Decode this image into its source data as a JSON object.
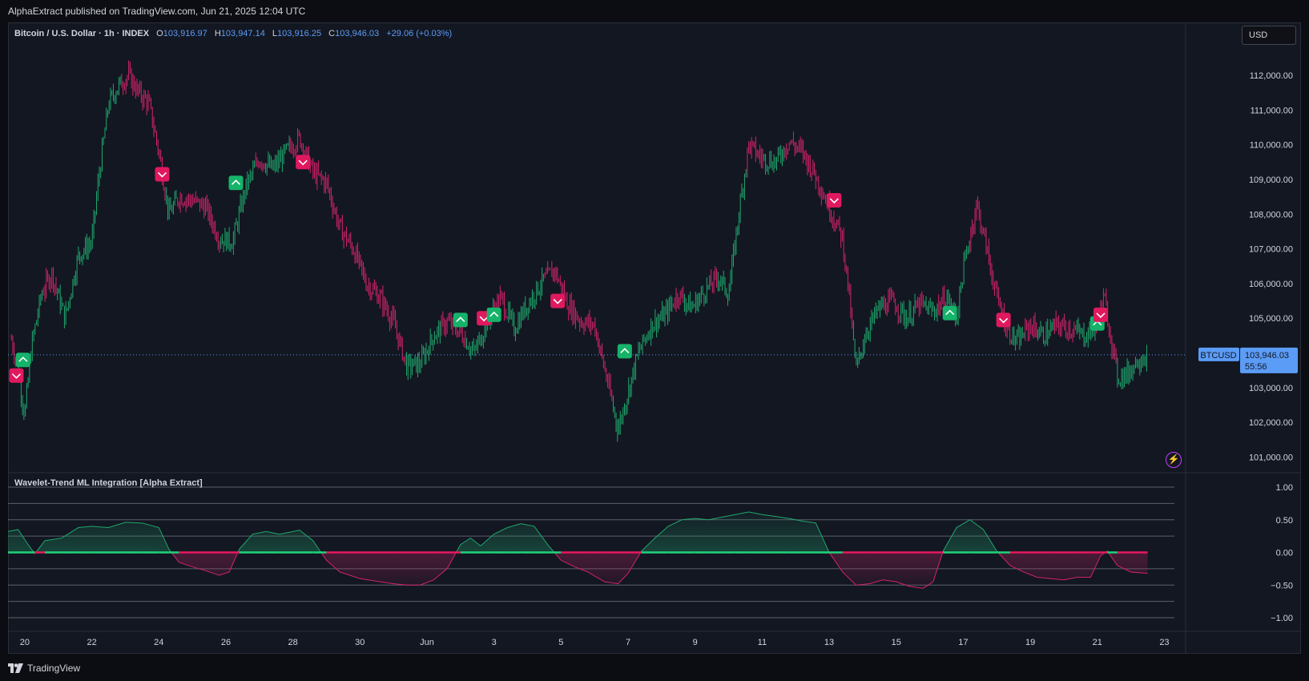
{
  "header": {
    "published": "AlphaExtract published on TradingView.com, Jun 21, 2025 12:04 UTC"
  },
  "symbol": {
    "name": "Bitcoin / U.S. Dollar · 1h · INDEX",
    "o_label": "O",
    "o_value": "103,916.97",
    "h_label": "H",
    "h_value": "103,947.14",
    "l_label": "L",
    "l_value": "103,916.25",
    "c_label": "C",
    "c_value": "103,946.03",
    "change": "+29.06 (+0.03%)"
  },
  "currency_button": "USD",
  "price_badge": {
    "ticker": "BTCUSD",
    "price": "103,946.03",
    "countdown": "55:56"
  },
  "indicator": {
    "title": "Wavelet-Trend ML Integration [Alpha Extract]"
  },
  "footer": {
    "brand": "TradingView"
  },
  "colors": {
    "up": "#089981",
    "down": "#f23645",
    "bull_candle": "#1fa86c",
    "bear_candle": "#d4236a",
    "accent": "#2962ff",
    "badge": "#5b9cf6",
    "background": "#131722"
  },
  "icons": [
    "tradingview-logo-icon",
    "lightning-icon",
    "buy-signal-icon",
    "sell-signal-icon"
  ],
  "chart_data": [
    {
      "type": "line",
      "name": "BTCUSD 1h price",
      "y_ticks": [
        "112,000.00",
        "111,000.00",
        "110,000.00",
        "109,000.00",
        "108,000.00",
        "107,000.00",
        "106,000.00",
        "105,000.00",
        "103,000.00",
        "102,000.00",
        "101,000.00"
      ],
      "ylim": [
        100550,
        112600
      ],
      "x_ticks": [
        "20",
        "22",
        "24",
        "26",
        "28",
        "30",
        "Jun",
        "3",
        "5",
        "7",
        "9",
        "11",
        "13",
        "15",
        "17",
        "19",
        "21",
        "23"
      ],
      "x_tick_index": [
        0,
        2,
        4,
        6,
        8,
        10,
        12,
        14,
        16,
        18,
        20,
        22,
        24,
        26,
        28,
        30,
        32,
        34
      ],
      "x_span_days": [
        -0.5,
        34.3
      ],
      "last_price": 103946.03,
      "series_points": [
        [
          -0.4,
          104400
        ],
        [
          -0.2,
          103500
        ],
        [
          0,
          102200
        ],
        [
          0.2,
          104200
        ],
        [
          0.5,
          105700
        ],
        [
          0.8,
          106300
        ],
        [
          1.2,
          105000
        ],
        [
          1.6,
          106800
        ],
        [
          2,
          107200
        ],
        [
          2.2,
          109000
        ],
        [
          2.5,
          111200
        ],
        [
          2.8,
          111700
        ],
        [
          3.1,
          112000
        ],
        [
          3.4,
          111500
        ],
        [
          3.7,
          111200
        ],
        [
          4,
          109800
        ],
        [
          4.3,
          108000
        ],
        [
          4.6,
          108500
        ],
        [
          5,
          108400
        ],
        [
          5.4,
          108200
        ],
        [
          5.8,
          107300
        ],
        [
          6.2,
          107200
        ],
        [
          6.6,
          108800
        ],
        [
          7,
          109600
        ],
        [
          7.4,
          109300
        ],
        [
          7.8,
          109800
        ],
        [
          8.2,
          110200
        ],
        [
          8.6,
          109200
        ],
        [
          9,
          108900
        ],
        [
          9.4,
          107600
        ],
        [
          9.8,
          107000
        ],
        [
          10.2,
          106000
        ],
        [
          10.6,
          105600
        ],
        [
          11,
          104900
        ],
        [
          11.4,
          103600
        ],
        [
          11.8,
          103700
        ],
        [
          12.2,
          104500
        ],
        [
          12.6,
          104900
        ],
        [
          13,
          104600
        ],
        [
          13.4,
          104000
        ],
        [
          13.8,
          104900
        ],
        [
          14.2,
          105600
        ],
        [
          14.6,
          104700
        ],
        [
          15,
          105400
        ],
        [
          15.4,
          106000
        ],
        [
          15.8,
          106400
        ],
        [
          16.2,
          105400
        ],
        [
          16.6,
          104900
        ],
        [
          17,
          104800
        ],
        [
          17.4,
          103100
        ],
        [
          17.7,
          101800
        ],
        [
          17.95,
          102700
        ],
        [
          18.3,
          104000
        ],
        [
          18.7,
          104800
        ],
        [
          19.1,
          105100
        ],
        [
          19.5,
          105700
        ],
        [
          19.9,
          105300
        ],
        [
          20.3,
          105800
        ],
        [
          20.7,
          106200
        ],
        [
          21,
          105700
        ],
        [
          21.3,
          108000
        ],
        [
          21.6,
          110000
        ],
        [
          22,
          109600
        ],
        [
          22.4,
          109500
        ],
        [
          22.8,
          110100
        ],
        [
          23.2,
          109800
        ],
        [
          23.6,
          109100
        ],
        [
          24,
          108200
        ],
        [
          24.4,
          107300
        ],
        [
          24.6,
          105600
        ],
        [
          24.8,
          103500
        ],
        [
          25.1,
          104600
        ],
        [
          25.5,
          105300
        ],
        [
          25.9,
          105500
        ],
        [
          26.3,
          105000
        ],
        [
          26.7,
          105400
        ],
        [
          27.1,
          105200
        ],
        [
          27.5,
          105600
        ],
        [
          27.8,
          105000
        ],
        [
          28,
          106400
        ],
        [
          28.4,
          108300
        ],
        [
          28.7,
          107000
        ],
        [
          29,
          105600
        ],
        [
          29.3,
          104700
        ],
        [
          29.6,
          104300
        ],
        [
          30,
          104800
        ],
        [
          30.4,
          104500
        ],
        [
          30.8,
          104800
        ],
        [
          31.2,
          104700
        ],
        [
          31.6,
          104500
        ],
        [
          31.9,
          104700
        ],
        [
          32.2,
          105600
        ],
        [
          32.4,
          104500
        ],
        [
          32.6,
          103300
        ],
        [
          32.9,
          103400
        ],
        [
          33.2,
          103800
        ],
        [
          33.5,
          103946
        ]
      ]
    },
    {
      "type": "area",
      "name": "Wavelet-Trend ML Integration [Alpha Extract]",
      "y_ticks": [
        "1.00",
        "0.50",
        "0.00",
        "−0.50",
        "−1.00"
      ],
      "ylim": [
        -1.0,
        1.0
      ],
      "levels": [
        1.0,
        0.75,
        0.5,
        0.25,
        0,
        -0.25,
        -0.5,
        -0.75,
        -1.0
      ],
      "series_points": [
        [
          -0.5,
          0.32
        ],
        [
          -0.2,
          0.35
        ],
        [
          0.1,
          0.12
        ],
        [
          0.3,
          -0.02
        ],
        [
          0.6,
          0.18
        ],
        [
          1.1,
          0.22
        ],
        [
          1.6,
          0.38
        ],
        [
          2,
          0.4
        ],
        [
          2.5,
          0.38
        ],
        [
          3,
          0.46
        ],
        [
          3.5,
          0.45
        ],
        [
          4,
          0.38
        ],
        [
          4.3,
          0.05
        ],
        [
          4.6,
          -0.15
        ],
        [
          5,
          -0.22
        ],
        [
          5.4,
          -0.28
        ],
        [
          5.8,
          -0.35
        ],
        [
          6.1,
          -0.3
        ],
        [
          6.4,
          0.05
        ],
        [
          6.8,
          0.28
        ],
        [
          7.2,
          0.32
        ],
        [
          7.6,
          0.28
        ],
        [
          8.2,
          0.34
        ],
        [
          8.6,
          0.18
        ],
        [
          9,
          -0.12
        ],
        [
          9.4,
          -0.3
        ],
        [
          10,
          -0.4
        ],
        [
          10.6,
          -0.45
        ],
        [
          11,
          -0.48
        ],
        [
          11.4,
          -0.5
        ],
        [
          11.8,
          -0.5
        ],
        [
          12.2,
          -0.42
        ],
        [
          12.6,
          -0.25
        ],
        [
          13,
          0.12
        ],
        [
          13.3,
          0.22
        ],
        [
          13.6,
          0.1
        ],
        [
          14,
          0.28
        ],
        [
          14.4,
          0.38
        ],
        [
          14.8,
          0.44
        ],
        [
          15.2,
          0.4
        ],
        [
          15.6,
          0.12
        ],
        [
          16,
          -0.12
        ],
        [
          16.4,
          -0.22
        ],
        [
          16.8,
          -0.3
        ],
        [
          17.3,
          -0.45
        ],
        [
          17.7,
          -0.48
        ],
        [
          18,
          -0.32
        ],
        [
          18.4,
          0.02
        ],
        [
          18.8,
          0.22
        ],
        [
          19.2,
          0.4
        ],
        [
          19.6,
          0.5
        ],
        [
          20,
          0.52
        ],
        [
          20.4,
          0.5
        ],
        [
          20.8,
          0.54
        ],
        [
          21.2,
          0.58
        ],
        [
          21.6,
          0.62
        ],
        [
          22,
          0.58
        ],
        [
          22.4,
          0.55
        ],
        [
          22.8,
          0.52
        ],
        [
          23.2,
          0.48
        ],
        [
          23.6,
          0.45
        ],
        [
          24,
          0.0
        ],
        [
          24.4,
          -0.3
        ],
        [
          24.8,
          -0.5
        ],
        [
          25.2,
          -0.48
        ],
        [
          25.6,
          -0.42
        ],
        [
          26,
          -0.45
        ],
        [
          26.4,
          -0.52
        ],
        [
          26.8,
          -0.55
        ],
        [
          27.1,
          -0.45
        ],
        [
          27.4,
          0.02
        ],
        [
          27.8,
          0.38
        ],
        [
          28.2,
          0.5
        ],
        [
          28.6,
          0.35
        ],
        [
          29,
          0.02
        ],
        [
          29.4,
          -0.2
        ],
        [
          29.8,
          -0.3
        ],
        [
          30.2,
          -0.38
        ],
        [
          30.6,
          -0.4
        ],
        [
          31,
          -0.42
        ],
        [
          31.4,
          -0.38
        ],
        [
          31.8,
          -0.38
        ],
        [
          32.1,
          -0.05
        ],
        [
          32.3,
          0.02
        ],
        [
          32.6,
          -0.2
        ],
        [
          33,
          -0.3
        ],
        [
          33.5,
          -0.32
        ]
      ]
    }
  ],
  "signals": [
    {
      "type": "sell",
      "day": -0.25,
      "price": 103350
    },
    {
      "type": "buy",
      "day": -0.05,
      "price": 103800
    },
    {
      "type": "sell",
      "day": 4.1,
      "price": 109150
    },
    {
      "type": "buy",
      "day": 6.3,
      "price": 108900
    },
    {
      "type": "sell",
      "day": 8.3,
      "price": 109500
    },
    {
      "type": "buy",
      "day": 13.0,
      "price": 104950
    },
    {
      "type": "sell",
      "day": 13.7,
      "price": 105000
    },
    {
      "type": "buy",
      "day": 14.0,
      "price": 105100
    },
    {
      "type": "sell",
      "day": 15.9,
      "price": 105500
    },
    {
      "type": "buy",
      "day": 17.9,
      "price": 104050
    },
    {
      "type": "sell",
      "day": 24.15,
      "price": 108400
    },
    {
      "type": "buy",
      "day": 27.6,
      "price": 105150
    },
    {
      "type": "sell",
      "day": 29.2,
      "price": 104950
    },
    {
      "type": "buy",
      "day": 32.0,
      "price": 104850
    },
    {
      "type": "sell",
      "day": 32.1,
      "price": 105100
    }
  ]
}
